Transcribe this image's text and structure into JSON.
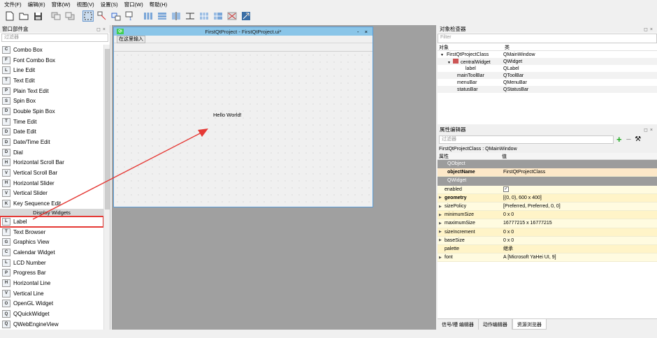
{
  "menubar": [
    "文件(F)",
    "编辑(E)",
    "窗体(W)",
    "视图(V)",
    "设置(S)",
    "窗口(W)",
    "帮助(H)"
  ],
  "widgetbox": {
    "title": "窗口部件盒",
    "filter_placeholder": "过滤器",
    "items_top": [
      {
        "label": "Combo Box",
        "icon": "combo-box-icon"
      },
      {
        "label": "Font Combo Box",
        "icon": "font-combo-icon"
      },
      {
        "label": "Line Edit",
        "icon": "line-edit-icon"
      },
      {
        "label": "Text Edit",
        "icon": "text-edit-icon"
      },
      {
        "label": "Plain Text Edit",
        "icon": "plain-text-edit-icon"
      },
      {
        "label": "Spin Box",
        "icon": "spin-box-icon"
      },
      {
        "label": "Double Spin Box",
        "icon": "double-spin-box-icon"
      },
      {
        "label": "Time Edit",
        "icon": "time-edit-icon"
      },
      {
        "label": "Date Edit",
        "icon": "date-edit-icon"
      },
      {
        "label": "Date/Time Edit",
        "icon": "datetime-edit-icon"
      },
      {
        "label": "Dial",
        "icon": "dial-icon"
      },
      {
        "label": "Horizontal Scroll Bar",
        "icon": "hscroll-icon"
      },
      {
        "label": "Vertical Scroll Bar",
        "icon": "vscroll-icon"
      },
      {
        "label": "Horizontal Slider",
        "icon": "hslider-icon"
      },
      {
        "label": "Vertical Slider",
        "icon": "vslider-icon"
      },
      {
        "label": "Key Sequence Edit",
        "icon": "key-sequence-icon"
      }
    ],
    "category": "Display Widgets",
    "items_bottom": [
      {
        "label": "Label",
        "icon": "label-icon"
      },
      {
        "label": "Text Browser",
        "icon": "text-browser-icon"
      },
      {
        "label": "Graphics View",
        "icon": "graphics-view-icon"
      },
      {
        "label": "Calendar Widget",
        "icon": "calendar-icon"
      },
      {
        "label": "LCD Number",
        "icon": "lcd-icon"
      },
      {
        "label": "Progress Bar",
        "icon": "progress-bar-icon"
      },
      {
        "label": "Horizontal Line",
        "icon": "hline-icon"
      },
      {
        "label": "Vertical Line",
        "icon": "vline-icon"
      },
      {
        "label": "OpenGL Widget",
        "icon": "opengl-icon"
      },
      {
        "label": "QQuickWidget",
        "icon": "qquick-icon"
      },
      {
        "label": "QWebEngineView",
        "icon": "webengine-icon"
      }
    ]
  },
  "form": {
    "title": "FirstQtProject - FirstQtProject.ui*",
    "logo": "Qt",
    "menu_placeholder": "在这里输入",
    "label_text": "Hello World!",
    "window_buttons": "- ×"
  },
  "object_inspector": {
    "title": "对象检查器",
    "filter_placeholder": "Filter",
    "col_object": "对象",
    "col_class": "类",
    "rows": [
      {
        "object": "FirstQtProjectClass",
        "class": "QMainWindow"
      },
      {
        "object": "centralWidget",
        "class": "QWidget"
      },
      {
        "object": "label",
        "class": "QLabel"
      },
      {
        "object": "mainToolBar",
        "class": "QToolBar"
      },
      {
        "object": "menuBar",
        "class": "QMenuBar"
      },
      {
        "object": "statusBar",
        "class": "QStatusBar"
      }
    ]
  },
  "property_editor": {
    "title": "属性编辑器",
    "filter_placeholder": "过滤器",
    "class_line": "FirstQtProjectClass : QMainWindow",
    "col_property": "属性",
    "col_value": "值",
    "group_qobject": "QObject",
    "object_name": {
      "name": "objectName",
      "value": "FirstQtProjectClass"
    },
    "group_qwidget": "QWidget",
    "rows": [
      {
        "name": "enabled",
        "value": "✓"
      },
      {
        "name": "geometry",
        "value": "[(0, 0), 600 x 400]"
      },
      {
        "name": "sizePolicy",
        "value": "[Preferred, Preferred, 0, 0]"
      },
      {
        "name": "minimumSize",
        "value": "0 x 0"
      },
      {
        "name": "maximumSize",
        "value": "16777215 x 16777215"
      },
      {
        "name": "sizeIncrement",
        "value": "0 x 0"
      },
      {
        "name": "baseSize",
        "value": "0 x 0"
      },
      {
        "name": "palette",
        "value": "继承"
      },
      {
        "name": "font",
        "value": "A  [Microsoft YaHei UI, 9]"
      }
    ]
  },
  "bottom_tabs": [
    "信号/槽 编辑器",
    "动作编辑器",
    "资源浏览器"
  ],
  "colors": {
    "accent": "#e53935",
    "title_bar": "#8ac5e8",
    "group_bar": "#9c9c9c"
  }
}
